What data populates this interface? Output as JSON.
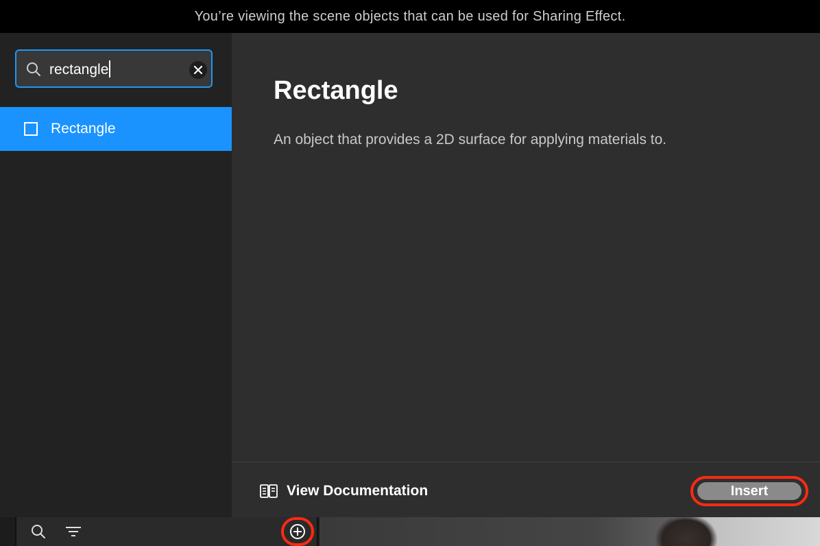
{
  "banner": {
    "text": "You’re viewing the scene objects that can be used for Sharing Effect."
  },
  "search": {
    "value": "rectangle",
    "icon": "search-icon",
    "clear_icon": "close-icon"
  },
  "results": [
    {
      "label": "Rectangle",
      "icon": "square-icon",
      "selected": true
    }
  ],
  "detail": {
    "title": "Rectangle",
    "description": "An object that provides a 2D surface for applying materials to."
  },
  "footer": {
    "doc_label": "View Documentation",
    "doc_icon": "book-icon",
    "insert_label": "Insert"
  },
  "colors": {
    "accent": "#1a93ff",
    "highlight": "#ff2a12",
    "insert_button": "#8a8a8a"
  },
  "toolbar": {
    "icons": [
      "search-icon",
      "filter-icon",
      "plus-circle-icon"
    ]
  }
}
